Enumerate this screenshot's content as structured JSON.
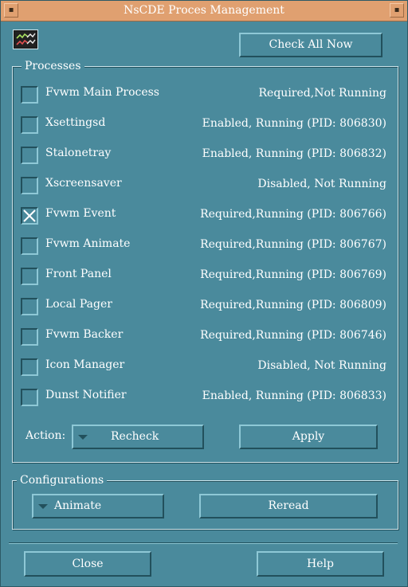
{
  "window": {
    "title": "NsCDE Proces Management",
    "min_btn": "▪",
    "max_btn": "▪"
  },
  "toolbar": {
    "check_all_label": "Check All Now"
  },
  "processes": {
    "legend": "Processes",
    "rows": [
      {
        "name": "Fvwm Main Process",
        "status": "Required,Not Running",
        "checked": false
      },
      {
        "name": "Xsettingsd",
        "status": "Enabled, Running (PID: 806830)",
        "checked": false
      },
      {
        "name": "Stalonetray",
        "status": "Enabled, Running (PID: 806832)",
        "checked": false
      },
      {
        "name": "Xscreensaver",
        "status": "Disabled, Not Running",
        "checked": false
      },
      {
        "name": "Fvwm Event",
        "status": "Required,Running (PID: 806766)",
        "checked": true
      },
      {
        "name": "Fvwm Animate",
        "status": "Required,Running (PID: 806767)",
        "checked": false
      },
      {
        "name": "Front Panel",
        "status": "Required,Running (PID: 806769)",
        "checked": false
      },
      {
        "name": "Local Pager",
        "status": "Required,Running (PID: 806809)",
        "checked": false
      },
      {
        "name": "Fvwm Backer",
        "status": "Required,Running (PID: 806746)",
        "checked": false
      },
      {
        "name": "Icon Manager",
        "status": "Disabled, Not Running",
        "checked": false
      },
      {
        "name": "Dunst Notifier",
        "status": "Enabled, Running (PID: 806833)",
        "checked": false
      }
    ],
    "action_label": "Action:",
    "action_value": "Recheck",
    "apply_label": "Apply"
  },
  "configurations": {
    "legend": "Configurations",
    "select_value": "Animate",
    "reread_label": "Reread"
  },
  "footer": {
    "close_label": "Close",
    "help_label": "Help"
  }
}
